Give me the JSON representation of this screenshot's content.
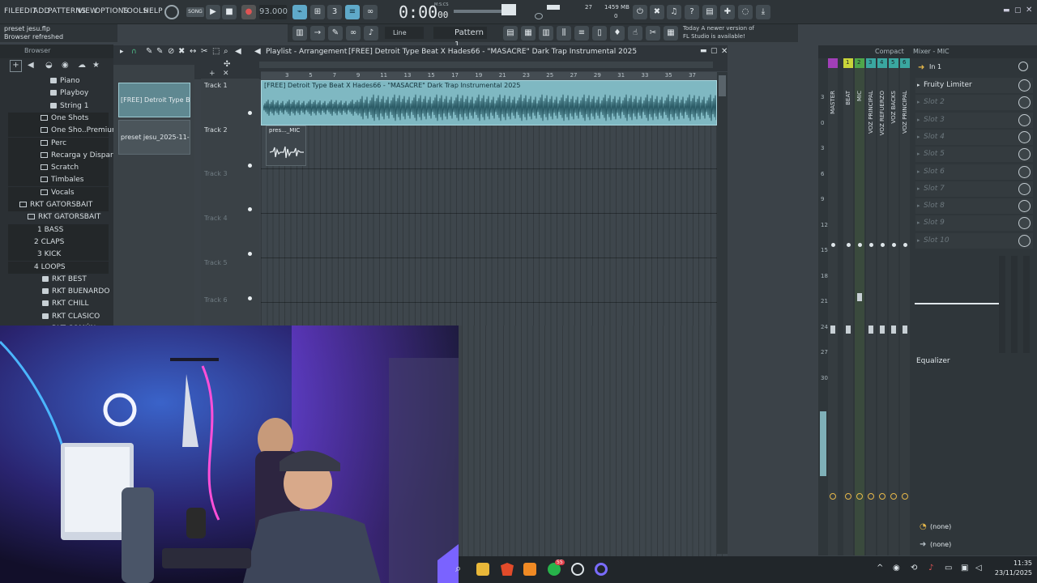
{
  "menu": [
    "FILE",
    "EDIT",
    "ADD",
    "PATTERNS",
    "VIEW",
    "OPTIONS",
    "TOOLS",
    "HELP"
  ],
  "transport": {
    "mode": "SONG",
    "tempo": "93.000",
    "time": "0:00",
    "time_sub": "00",
    "time_unit": "M:S:CS",
    "cpu": "27",
    "memory": "1459 MB",
    "polyphony": "0"
  },
  "hint": {
    "line1": "preset jesu.flp",
    "line2": "Browser refreshed"
  },
  "toolbar2": {
    "snap": "Line",
    "pattern": "Pattern 1"
  },
  "news": {
    "line1": "Today  A newer version of",
    "line2": "FL Studio is available!"
  },
  "browser": {
    "title": "Browser",
    "items": [
      {
        "label": "Piano",
        "kind": "file"
      },
      {
        "label": "Playboy",
        "kind": "file"
      },
      {
        "label": "String 1",
        "kind": "file"
      },
      {
        "label": "One Shots",
        "kind": "folder"
      },
      {
        "label": "One Sho..Premium",
        "kind": "folder"
      },
      {
        "label": "Perc",
        "kind": "folder"
      },
      {
        "label": "Recarga y Disparo",
        "kind": "folder"
      },
      {
        "label": "Scratch",
        "kind": "folder"
      },
      {
        "label": "Timbales",
        "kind": "folder"
      },
      {
        "label": "Vocals",
        "kind": "folder"
      },
      {
        "label": "RKT GATORSBAIT",
        "kind": "folder"
      },
      {
        "label": "RKT GATORSBAIT",
        "kind": "folder"
      },
      {
        "label": "BASS",
        "kind": "num",
        "num": "1"
      },
      {
        "label": "CLAPS",
        "kind": "num",
        "num": "2"
      },
      {
        "label": "KICK",
        "kind": "num",
        "num": "3"
      },
      {
        "label": "LOOPS",
        "kind": "num",
        "num": "4"
      },
      {
        "label": "RKT BEST",
        "kind": "file"
      },
      {
        "label": "RKT BUENARDO",
        "kind": "file"
      },
      {
        "label": "RKT CHILL",
        "kind": "file"
      },
      {
        "label": "RKT CLASICO",
        "kind": "file"
      },
      {
        "label": "RKT COMÚN",
        "kind": "file"
      }
    ]
  },
  "playlist": {
    "title": "Playlist - Arrangement",
    "song": "[FREE] Detroit Type Beat X Hades66 - \"MASACRE\"  Dark Trap Instrumental 2025",
    "picker": [
      {
        "label": "[FREE] Detroit Type B..."
      },
      {
        "label": "preset jesu_2025-11-23..."
      }
    ],
    "bars": [
      "3",
      "5",
      "7",
      "9",
      "11",
      "13",
      "15",
      "17",
      "19",
      "21",
      "23",
      "25",
      "27",
      "29",
      "31",
      "33",
      "35",
      "37"
    ],
    "tracks": [
      "Track 1",
      "Track 2",
      "Track 3",
      "Track 4",
      "Track 5",
      "Track 6"
    ],
    "clip1": "[FREE] Detroit Type Beat X Hades66 - \"MASACRE\"  Dark Trap Instrumental 2025",
    "clip2": "pres..._MIC"
  },
  "mixer": {
    "title": "Compact",
    "tracks": [
      "MASTER",
      "BEAT",
      "MIC",
      "VOZ PRINCIPAL",
      "VOZ REFUERZO",
      "VOZ BACKS",
      "VOZ PRINCIPAL"
    ],
    "track_nums": [
      "1",
      "2",
      "3",
      "4",
      "5",
      "6"
    ],
    "db_scale": [
      "3",
      "0",
      "3",
      "6",
      "9",
      "12",
      "15",
      "18",
      "21",
      "24",
      "27",
      "30"
    ]
  },
  "fx": {
    "title": "Mixer - MIC",
    "input": "In 1",
    "slots": [
      "Fruity Limiter",
      "Slot 2",
      "Slot 3",
      "Slot 4",
      "Slot 5",
      "Slot 6",
      "Slot 7",
      "Slot 8",
      "Slot 9",
      "Slot 10"
    ],
    "eq": "Equalizer",
    "send1": "(none)",
    "send2": "(none)"
  },
  "taskbar": {
    "whatsapp_badge": "55",
    "time": "11:35",
    "date": "23/11/2025"
  },
  "colors": {
    "accent": "#5fa9c9",
    "clip": "#7fb8c2",
    "master": "#a23fb8",
    "beat": "#c9d53a",
    "mic": "#4fa64a",
    "voz": "#3aa7a0"
  }
}
